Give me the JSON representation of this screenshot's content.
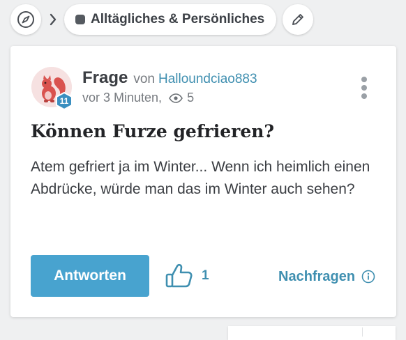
{
  "breadcrumb": {
    "category": "Alltägliches & Persönliches",
    "icons": [
      "compass-icon",
      "chevron-right-icon",
      "pencil-icon"
    ]
  },
  "post": {
    "type_label": "Frage",
    "by_label": "von",
    "author": "Halloundciao883",
    "author_level": "11",
    "time": "vor 3 Minuten,",
    "views": "5",
    "title": "Können Furze gefrieren?",
    "body": "Atem gefriert ja im Winter... Wenn ich heimlich einen Abdrücke, würde man das im Winter auch sehen?",
    "answer_label": "Antworten",
    "likes": "1",
    "ask_label": "Nachfragen"
  },
  "colors": {
    "accent": "#48a3cf",
    "link": "#3f8fb0",
    "background": "#eff0f1",
    "badge": "#3a8fc0",
    "avatar_bg": "#f6e1e1",
    "avatar_figure": "#d9534f"
  }
}
